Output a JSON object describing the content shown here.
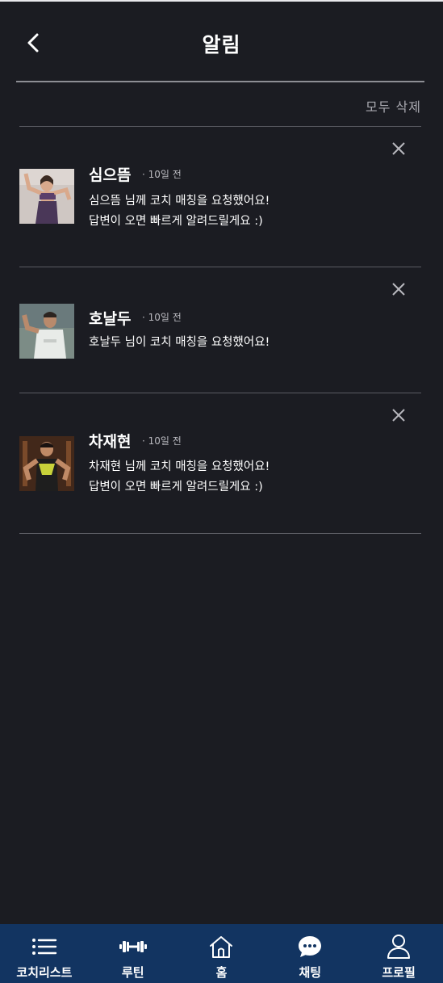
{
  "header": {
    "title": "알림",
    "back_icon": "chevron-left-icon"
  },
  "actions": {
    "delete_all_label": "모두 삭제"
  },
  "notifications": [
    {
      "name": "심으뜸",
      "time": "· 10일 전",
      "line1": "심으뜸 님께 코치 매칭을 요청했어요!",
      "line2": "답변이 오면 빠르게 알려드릴게요 :)"
    },
    {
      "name": "호날두",
      "time": "· 10일 전",
      "line1": "호날두 님이 코치 매칭을 요청했어요!",
      "line2": ""
    },
    {
      "name": "차재현",
      "time": "· 10일 전",
      "line1": "차재현 님께 코치 매칭을 요청했어요!",
      "line2": "답변이 오면 빠르게 알려드릴게요 :)"
    }
  ],
  "nav": [
    {
      "label": "코치리스트",
      "icon": "list-icon"
    },
    {
      "label": "루틴",
      "icon": "dumbbell-icon"
    },
    {
      "label": "홈",
      "icon": "home-icon"
    },
    {
      "label": "채팅",
      "icon": "chat-bubble-icon"
    },
    {
      "label": "프로필",
      "icon": "person-icon"
    }
  ],
  "colors": {
    "background": "#1b1c22",
    "nav_background": "#123461",
    "muted_text": "#a9a9b0"
  }
}
